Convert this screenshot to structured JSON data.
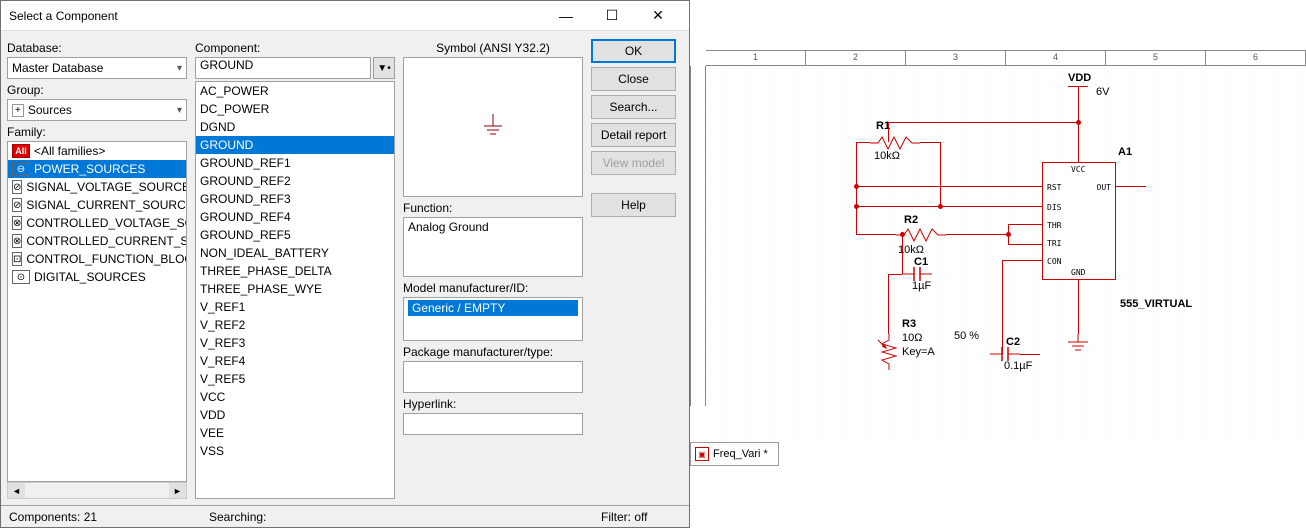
{
  "window": {
    "title": "Select a Component"
  },
  "labels": {
    "database": "Database:",
    "group": "Group:",
    "family": "Family:",
    "component": "Component:",
    "symbol": "Symbol (ANSI Y32.2)",
    "function": "Function:",
    "model": "Model manufacturer/ID:",
    "package": "Package manufacturer/type:",
    "hyperlink": "Hyperlink:"
  },
  "database_value": "Master Database",
  "group_value": "Sources",
  "component_value": "GROUND",
  "families": [
    {
      "icon": "All",
      "label": "<All families>"
    },
    {
      "icon": "⊖",
      "label": "POWER_SOURCES"
    },
    {
      "icon": "⊘",
      "label": "SIGNAL_VOLTAGE_SOURCES"
    },
    {
      "icon": "⊘",
      "label": "SIGNAL_CURRENT_SOURCES"
    },
    {
      "icon": "⊗",
      "label": "CONTROLLED_VOLTAGE_SOUR"
    },
    {
      "icon": "⊗",
      "label": "CONTROLLED_CURRENT_SOUR"
    },
    {
      "icon": "⊡",
      "label": "CONTROL_FUNCTION_BLOCKS"
    },
    {
      "icon": "⊙",
      "label": "DIGITAL_SOURCES"
    }
  ],
  "components": [
    "AC_POWER",
    "DC_POWER",
    "DGND",
    "GROUND",
    "GROUND_REF1",
    "GROUND_REF2",
    "GROUND_REF3",
    "GROUND_REF4",
    "GROUND_REF5",
    "NON_IDEAL_BATTERY",
    "THREE_PHASE_DELTA",
    "THREE_PHASE_WYE",
    "V_REF1",
    "V_REF2",
    "V_REF3",
    "V_REF4",
    "V_REF5",
    "VCC",
    "VDD",
    "VEE",
    "VSS"
  ],
  "selected_component_index": 3,
  "function_text": "Analog Ground",
  "model_text": "Generic / EMPTY",
  "buttons": {
    "ok": "OK",
    "close": "Close",
    "search": "Search...",
    "detail": "Detail report",
    "view": "View model",
    "help": "Help"
  },
  "status": {
    "components": "Components: 21",
    "searching": "Searching:",
    "filter": "Filter: off"
  },
  "ruler": [
    "1",
    "2",
    "3",
    "4",
    "5",
    "6"
  ],
  "tab": {
    "label": "Freq_Vari *"
  },
  "circuit": {
    "vdd": {
      "name": "VDD",
      "value": "6V"
    },
    "a1": {
      "name": "A1"
    },
    "ic_label": "555_VIRTUAL",
    "ic_pins": {
      "vcc": "VCC",
      "rst": "RST",
      "out": "OUT",
      "dis": "DIS",
      "thr": "THR",
      "tri": "TRI",
      "con": "CON",
      "gnd": "GND"
    },
    "r1": {
      "name": "R1",
      "value": "10kΩ"
    },
    "r2": {
      "name": "R2",
      "value": "10kΩ"
    },
    "r3": {
      "name": "R3",
      "value": "10Ω",
      "key": "Key=A",
      "pct": "50 %"
    },
    "c1": {
      "name": "C1",
      "value": "1µF"
    },
    "c2": {
      "name": "C2",
      "value": "0.1µF"
    }
  }
}
